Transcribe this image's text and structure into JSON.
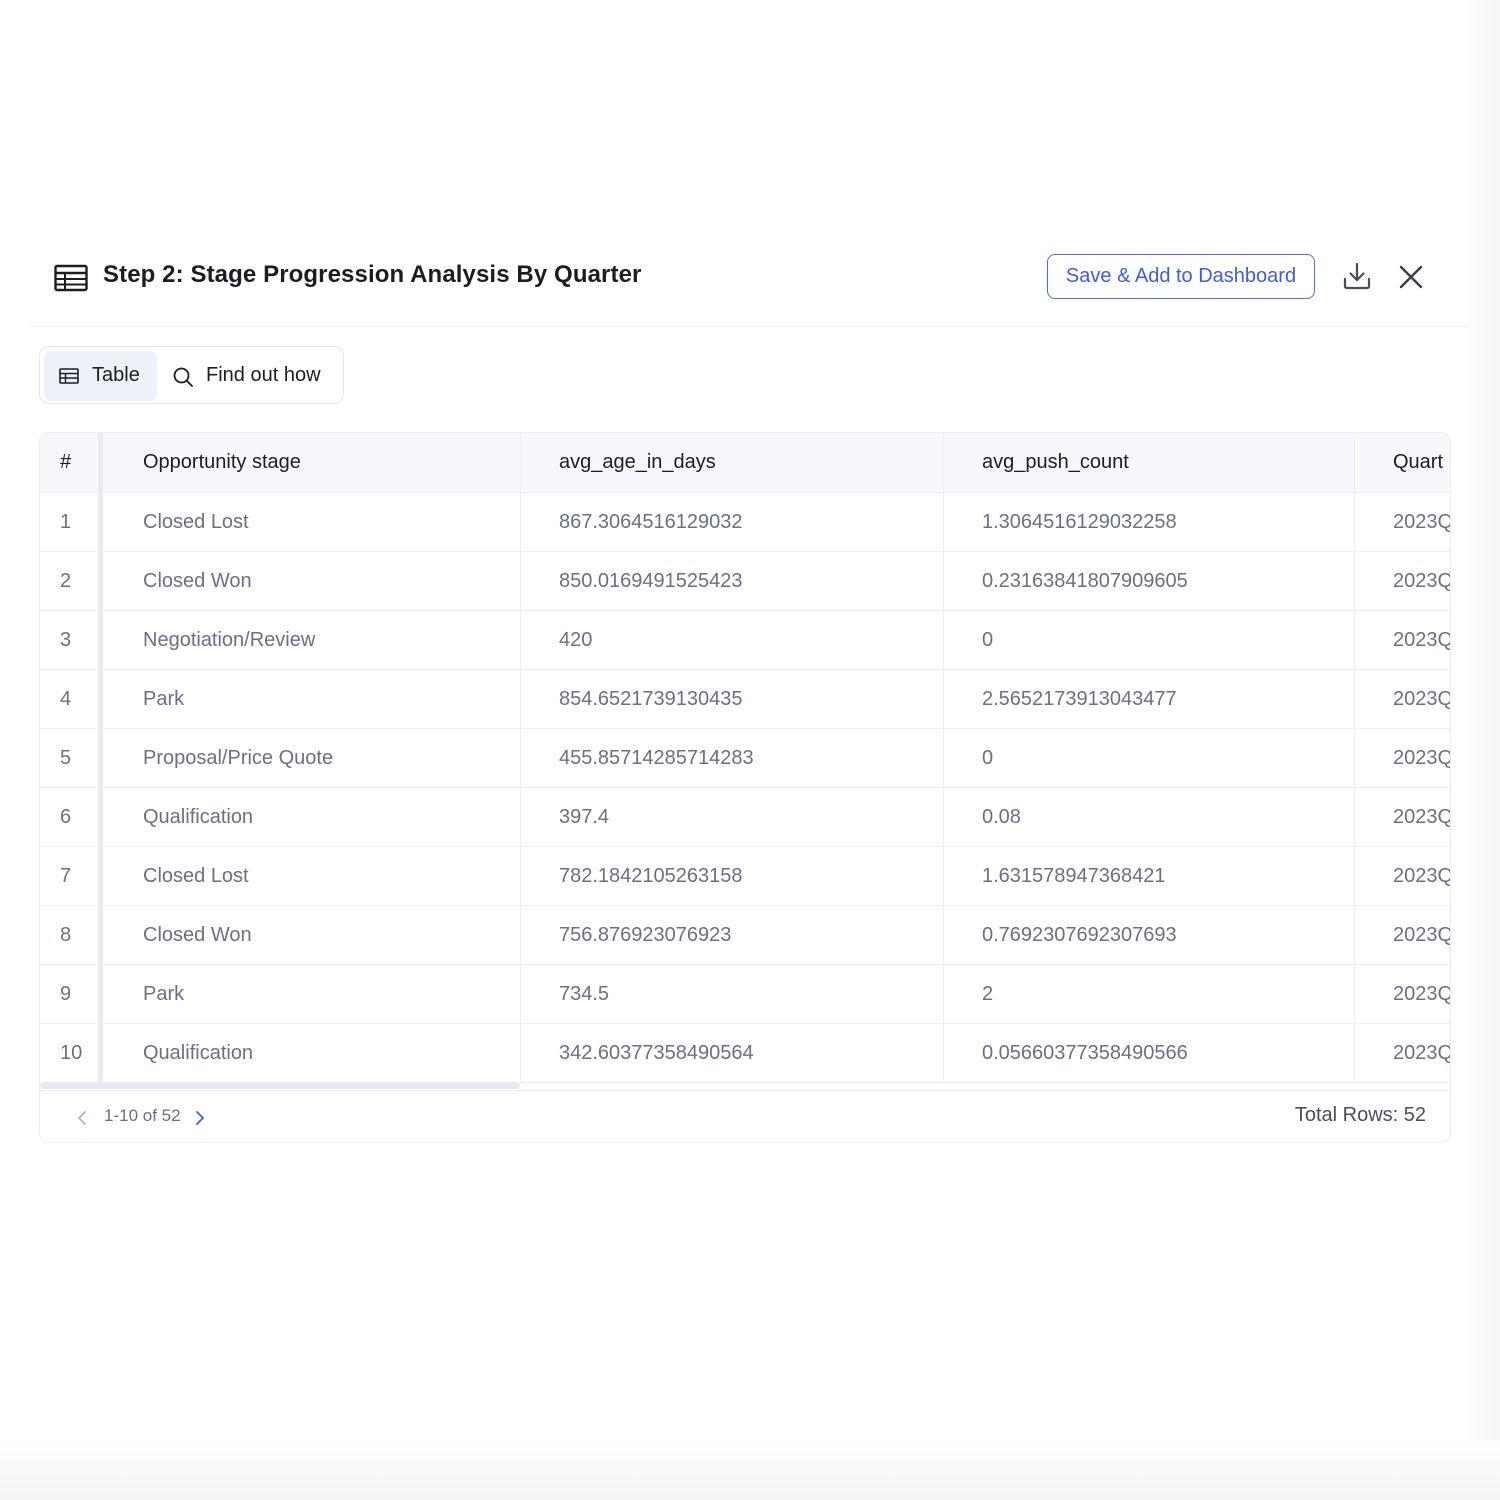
{
  "header": {
    "title": "Step 2: Stage Progression Analysis By Quarter",
    "save_button_label": "Save & Add to Dashboard",
    "title_icon": "table-icon",
    "download_icon": "download-icon",
    "close_icon": "close-icon"
  },
  "tabs": [
    {
      "label": "Table",
      "icon": "table-icon",
      "active": true
    },
    {
      "label": "Find out how",
      "icon": "search-icon",
      "active": false
    }
  ],
  "table": {
    "columns": [
      "#",
      "Opportunity stage",
      "avg_age_in_days",
      "avg_push_count",
      "Quart"
    ],
    "rows": [
      [
        "1",
        "Closed Lost",
        "867.3064516129032",
        "1.3064516129032258",
        "2023Q"
      ],
      [
        "2",
        "Closed Won",
        "850.0169491525423",
        "0.23163841807909605",
        "2023Q"
      ],
      [
        "3",
        "Negotiation/Review",
        "420",
        "0",
        "2023Q"
      ],
      [
        "4",
        "Park",
        "854.6521739130435",
        "2.5652173913043477",
        "2023Q"
      ],
      [
        "5",
        "Proposal/Price Quote",
        "455.85714285714283",
        "0",
        "2023Q"
      ],
      [
        "6",
        "Qualification",
        "397.4",
        "0.08",
        "2023Q"
      ],
      [
        "7",
        "Closed Lost",
        "782.1842105263158",
        "1.631578947368421",
        "2023Q"
      ],
      [
        "8",
        "Closed Won",
        "756.876923076923",
        "0.7692307692307693",
        "2023Q"
      ],
      [
        "9",
        "Park",
        "734.5",
        "2",
        "2023Q"
      ],
      [
        "10",
        "Qualification",
        "342.60377358490564",
        "0.05660377358490566",
        "2023Q"
      ]
    ]
  },
  "pagination": {
    "range_text": "1-10 of 52",
    "total_rows_text": "Total Rows: 52"
  },
  "colors": {
    "accent": "#3f5ce0",
    "header_bg": "#f7f8fb",
    "active_tab_bg": "#eef1f8",
    "body_text": "#6b6f86",
    "title_text": "#1c1d22",
    "border": "#eceef2"
  }
}
